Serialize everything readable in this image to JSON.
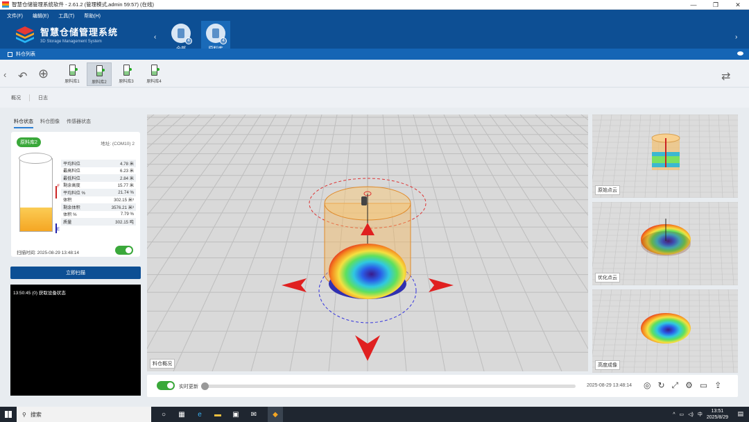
{
  "window": {
    "title": "智慧仓储管理系统软件 - 2.61.2 (管理模式,admin 59:57) (在线)",
    "minimize": "—",
    "maximize": "❐",
    "close": "✕"
  },
  "menu": [
    "文件(F)",
    "编辑(E)",
    "工具(T)",
    "帮助(H)"
  ],
  "brand": {
    "cn": "智慧仓储管理系统",
    "en": "3D Storage Management System"
  },
  "warehouses": [
    {
      "label": "全部",
      "badge": "4"
    },
    {
      "label": "原料库",
      "badge": "4"
    }
  ],
  "nav": {
    "prev": "‹",
    "next": "›"
  },
  "subbar": {
    "title": "料仓列表"
  },
  "toolbar": {
    "back": "‹",
    "undo": "↶",
    "add": "⊕",
    "refresh": "⇄"
  },
  "silos": [
    "原料库1",
    "原料库2",
    "原料库3",
    "原料库4"
  ],
  "main_tabs": [
    "概况",
    "日志"
  ],
  "left_tabs": [
    "料仓状态",
    "料仓图像",
    "传感器状态"
  ],
  "status_card": {
    "tag": "原料库2",
    "address": "地址: (COM10) 2",
    "rows": [
      {
        "k": "平均料位",
        "v": "4.78 米"
      },
      {
        "k": "最高料位",
        "v": "6.23 米"
      },
      {
        "k": "最低料位",
        "v": "2.84 米"
      },
      {
        "k": "剩余高度",
        "v": "15.77 米"
      },
      {
        "k": "平均料位 %",
        "v": "21.74 %"
      },
      {
        "k": "体积",
        "v": "302.15 米³"
      },
      {
        "k": "剩余体积",
        "v": "3576.21 米³"
      },
      {
        "k": "体积 %",
        "v": "7.79 %"
      },
      {
        "k": "质量",
        "v": "302.15 吨"
      }
    ],
    "scan_time": "扫描时间: 2025-08-29 13:48:14",
    "marker_top": "F",
    "marker_bottom": "E"
  },
  "scan_button": "立即扫描",
  "log": [
    "13:50:45 (0) 获取设备状态"
  ],
  "views": {
    "main": "料仓概况",
    "v1": "原始点云",
    "v2": "优化点云",
    "v3": "高度成像"
  },
  "bottom": {
    "realtime": "实时更新",
    "timestamp": "2025-08-29 13:48:14",
    "progress": 0.0
  },
  "taskbar": {
    "search": "搜索",
    "ime": "中",
    "time": "13:51",
    "date": "2025/8/29"
  },
  "colors": {
    "header": "#0d4f94",
    "accent": "#1565b5",
    "toggle": "#3aa83a"
  }
}
